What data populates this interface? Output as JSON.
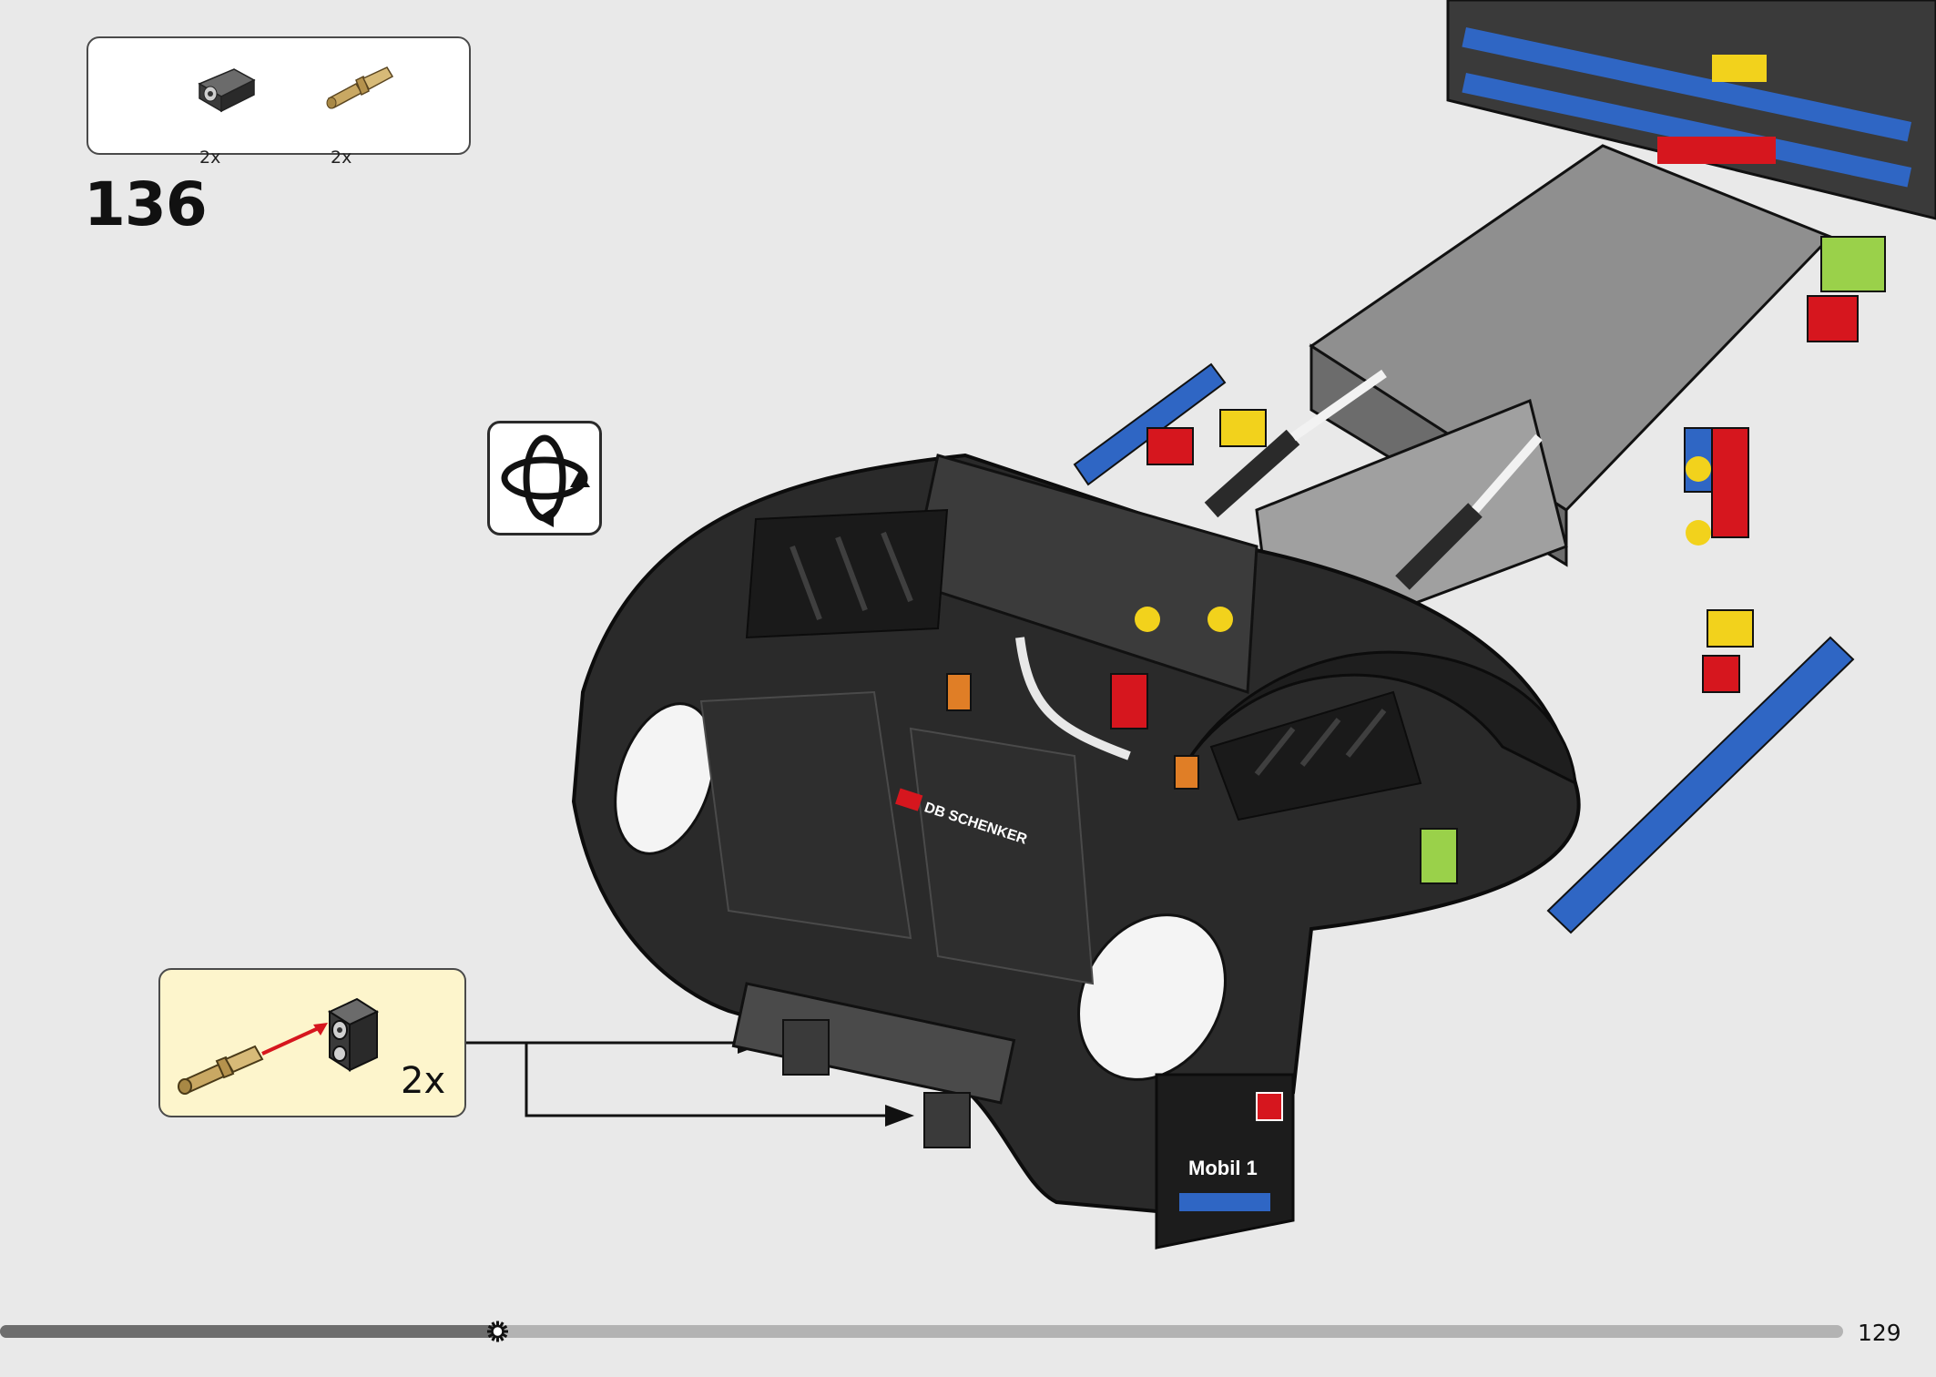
{
  "parts_list": {
    "items": [
      {
        "name": "technic-pin-connector-black",
        "quantity": "2x"
      },
      {
        "name": "technic-axle-pin-tan",
        "quantity": "2x"
      }
    ]
  },
  "step": {
    "number": "136"
  },
  "rotate_instruction": {
    "icon": "rotate-model-icon"
  },
  "callout": {
    "quantity": "2x"
  },
  "model_decals": {
    "sponsor_1": "DB SCHENKER",
    "sponsor_2": "Mobil 1"
  },
  "progress": {
    "fraction": 0.27,
    "track_color": "#b3b3b3",
    "fill_color": "#6d6d6d"
  },
  "page": {
    "number": "129"
  },
  "colors": {
    "callout_bg": "#fdf5cc",
    "page_bg": "#e9e9e9",
    "arrow_red": "#d6161e"
  }
}
